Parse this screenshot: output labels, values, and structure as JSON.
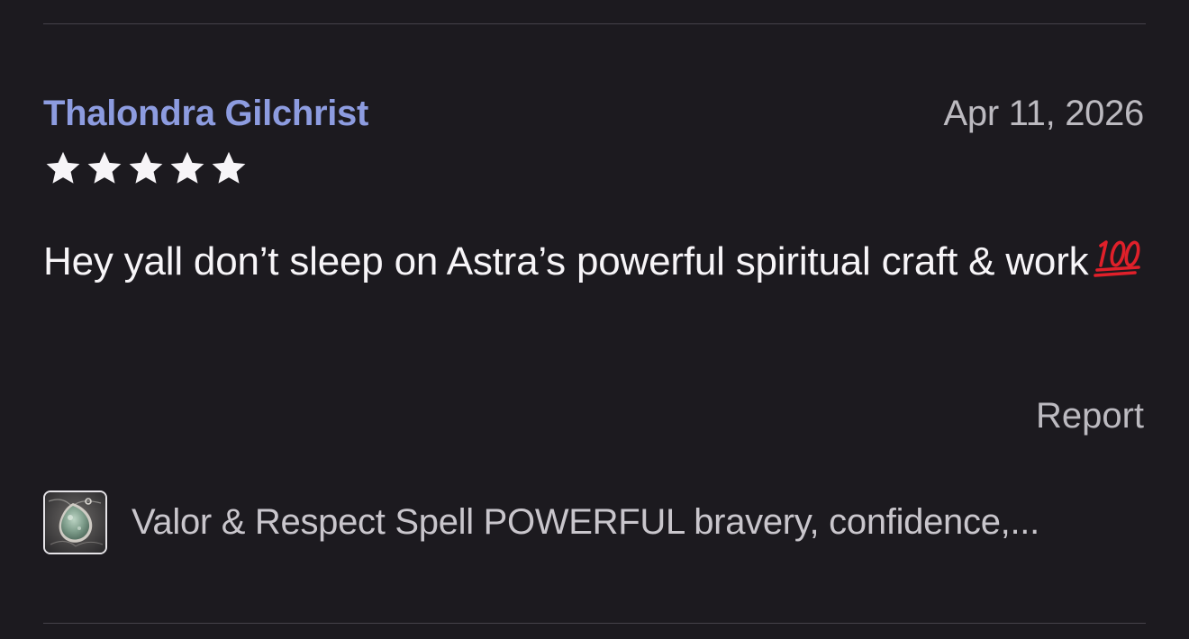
{
  "review": {
    "reviewer_name": "Thalondra Gilchrist",
    "date": "Apr 11, 2026",
    "rating": 5,
    "rating_max": 5,
    "text": "Hey yall don’t sleep on Astra’s powerful spiritual craft & work",
    "emoji_icon": "hundred-points-icon",
    "report_label": "Report"
  },
  "product": {
    "title": "Valor & Respect Spell POWERFUL bravery, confidence,...",
    "thumbnail_icon": "pendant-thumbnail"
  },
  "colors": {
    "background": "#1c1a1f",
    "reviewer_name": "#8d9ce0",
    "muted_text": "#bcbac0",
    "body_text": "#f7f5f8",
    "star": "#f7f5f8",
    "emoji_red": "#e0202a"
  }
}
